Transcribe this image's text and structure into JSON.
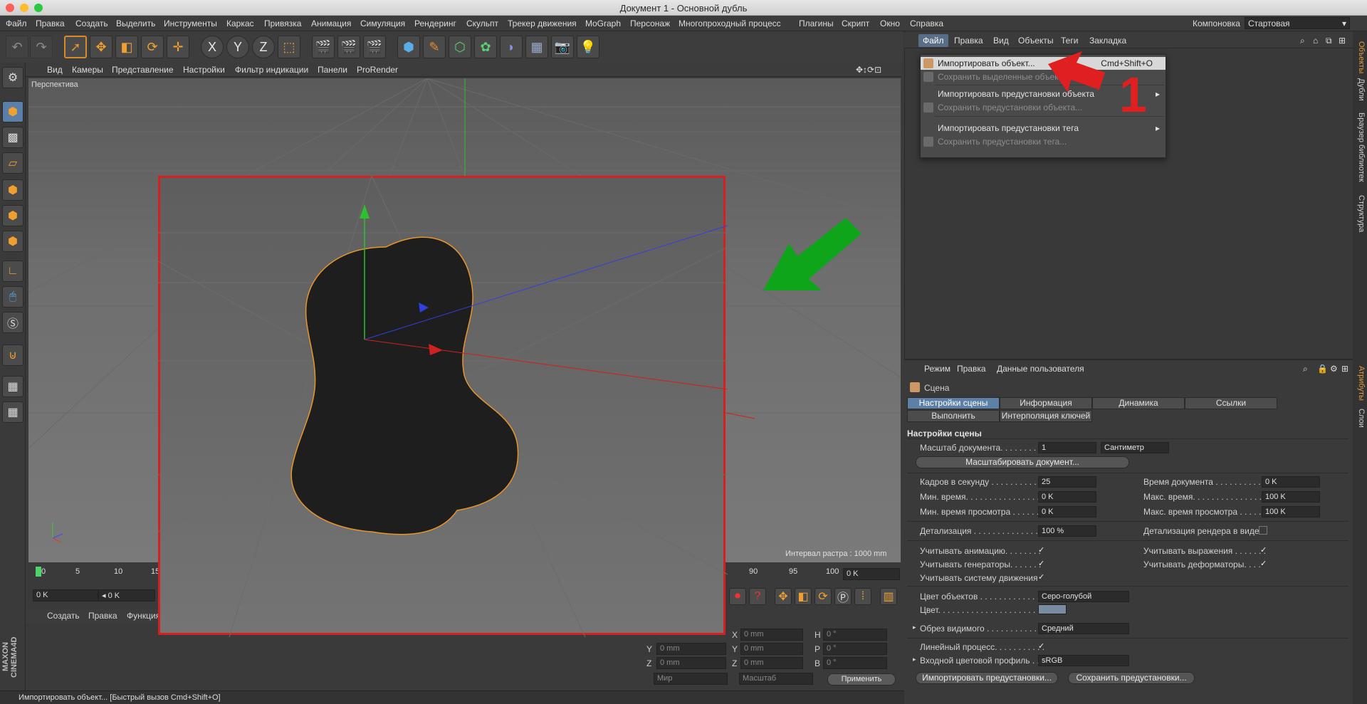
{
  "window": {
    "title": "Документ 1 - Основной дубль"
  },
  "menubar": {
    "items": [
      "Файл",
      "Правка",
      "Создать",
      "Выделить",
      "Инструменты",
      "Каркас",
      "Привязка",
      "Анимация",
      "Симуляция",
      "Рендеринг",
      "Скульпт",
      "Трекер движения",
      "MoGraph",
      "Персонаж",
      "Многопроходный процесс",
      "Плагины",
      "Скрипт",
      "Окно",
      "Справка"
    ],
    "layout_label": "Компоновка",
    "layout_value": "Стартовая"
  },
  "toolbar": {
    "undo_icon": "undo-icon",
    "axes": [
      "X",
      "Y",
      "Z"
    ]
  },
  "viewport": {
    "menu": [
      "Вид",
      "Камеры",
      "Представление",
      "Настройки",
      "Фильтр индикации",
      "Панели",
      "ProRender"
    ],
    "label": "Перспектива",
    "raster": "Интервал растра : 1000 mm"
  },
  "timeline": {
    "ticks": [
      "0",
      "5",
      "10",
      "15",
      "90",
      "95",
      "100"
    ],
    "start_field": "0 K",
    "prev_field": "◂ 0 K",
    "end_field": "0 K"
  },
  "material_bar": {
    "items": [
      "Создать",
      "Правка",
      "Функция"
    ]
  },
  "coords": {
    "labels_left": [
      "X",
      "Y",
      "Z"
    ],
    "labels_mid": [
      "X",
      "Y",
      "Z"
    ],
    "labels_right": [
      "H",
      "P",
      "B"
    ],
    "pos": [
      "0 mm",
      "0 mm",
      "0 mm"
    ],
    "size": [
      "0 mm",
      "0 mm",
      "0 mm"
    ],
    "rot": [
      "0 °",
      "0 °",
      "0 °"
    ],
    "world": "Мир",
    "scale": "Масштаб",
    "apply": "Применить"
  },
  "statusbar": {
    "text": "Импортировать объект... [Быстрый вызов Cmd+Shift+O]"
  },
  "logo": {
    "text": "MAXON CINEMA4D"
  },
  "object_manager": {
    "menu": [
      "Файл",
      "Правка",
      "Вид",
      "Объекты",
      "Теги",
      "Закладка"
    ],
    "active_menu": "Файл"
  },
  "dropdown": {
    "items": [
      {
        "label": "Импортировать объект...",
        "shortcut": "Cmd+Shift+O",
        "state": "highlighted"
      },
      {
        "label": "Сохранить выделенные объекты...",
        "shortcut": "",
        "state": "disabled"
      },
      {
        "label": "Импортировать предустановки объекта",
        "shortcut": "",
        "state": "submenu"
      },
      {
        "label": "Сохранить предустановки объекта...",
        "shortcut": "",
        "state": "disabled"
      },
      {
        "label": "Импортировать предустановки тега",
        "shortcut": "",
        "state": "submenu"
      },
      {
        "label": "Сохранить предустановки тега...",
        "shortcut": "",
        "state": "disabled"
      }
    ]
  },
  "annotation": {
    "number": "1",
    "red_color": "#e02020",
    "green_color": "#0ea51a"
  },
  "side_tabs": {
    "top": [
      "Объекты",
      "Дубли",
      "Браузер библиотек",
      "Структура"
    ],
    "bottom": [
      "Атрибуты",
      "Слои"
    ]
  },
  "attributes": {
    "menu": [
      "Режим",
      "Правка",
      "Данные пользователя"
    ],
    "object_name": "Сцена",
    "tabs_row1": [
      "Настройки сцены",
      "Информация",
      "Динамика",
      "Ссылки"
    ],
    "tabs_row2": [
      "Выполнить",
      "Интерполяция ключей"
    ],
    "section": "Настройки сцены",
    "doc_scale_label": "Масштаб документа. . . . . . . . . .",
    "doc_scale_value": "1",
    "doc_scale_unit": "Сантиметр",
    "scale_doc_btn": "Масштабировать документ...",
    "fps_label": "Кадров в секунду . . . . . . . . . . .",
    "fps_value": "25",
    "doc_time_label": "Время документа . . . . . . . . . . .",
    "doc_time_value": "0 K",
    "min_time_label": "Мин. время. . . . . . . . . . . . . . . .",
    "min_time_value": "0 K",
    "max_time_label": "Макс. время. . . . . . . . . . . . . . .",
    "max_time_value": "100 K",
    "min_preview_label": "Мин. время просмотра . . . . . .",
    "min_preview_value": "0 K",
    "max_preview_label": "Макс. время просмотра . . . . .",
    "max_preview_value": "100 K",
    "lod_label": "Детализация . . . . . . . . . . . . . . .",
    "lod_value": "100 %",
    "render_lod_label": "Детализация рендера в виде",
    "use_anim_label": "Учитывать анимацию. . . . . . . .",
    "use_expr_label": "Учитывать выражения . . . . . . .",
    "use_gen_label": "Учитывать генераторы. . . . . . .",
    "use_deform_label": "Учитывать деформаторы. . . .",
    "use_motion_label": "Учитывать систему движения",
    "obj_color_label": "Цвет объектов . . . . . . . . . . . . .",
    "obj_color_value": "Серо-голубой",
    "color_label": "Цвет. . . . . . . . . . . . . . . . . . . . . .",
    "color_swatch": "#7a8da0",
    "clip_label": "Обрез видимого . . . . . . . . . . . .",
    "clip_value": "Средний",
    "linear_label": "Линейный процесс. . . . . . . . . . .",
    "profile_label": "Входной цветовой профиль . .",
    "profile_value": "sRGB",
    "import_presets_btn": "Импортировать предустановки...",
    "save_presets_btn": "Сохранить предустановки..."
  }
}
